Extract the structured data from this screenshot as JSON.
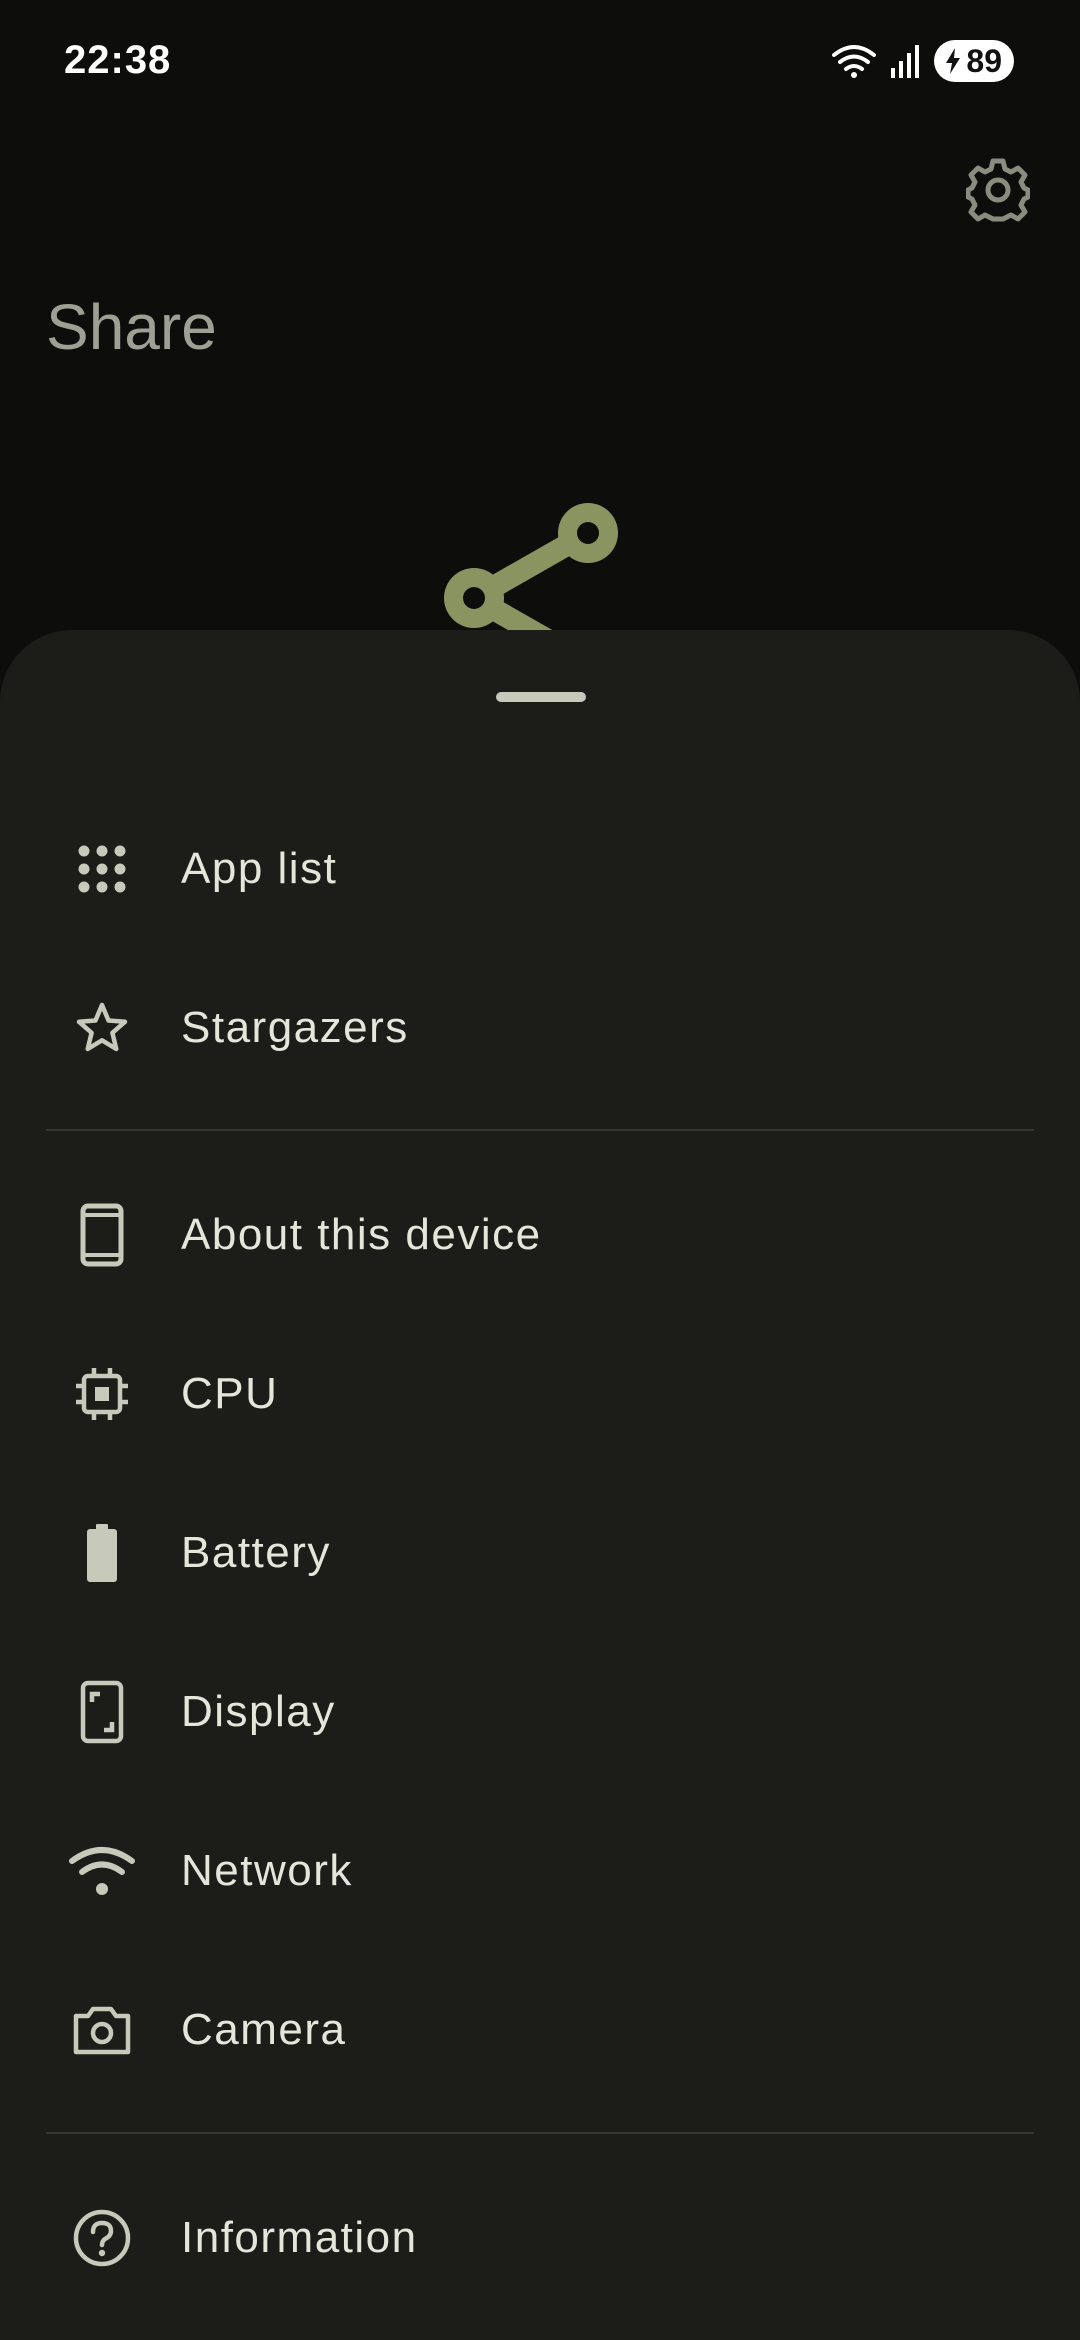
{
  "status_bar": {
    "time": "22:38",
    "battery_level": "89",
    "icons": [
      "wifi-icon",
      "cell-signal-icon",
      "battery-charging-icon"
    ]
  },
  "header": {
    "title": "Share",
    "settings_icon": "gear-icon"
  },
  "sheet": {
    "groups": [
      {
        "items": [
          {
            "label": "App list",
            "icon": "app-grid-icon"
          },
          {
            "label": "Stargazers",
            "icon": "star-icon"
          }
        ]
      },
      {
        "items": [
          {
            "label": "About this device",
            "icon": "phone-icon"
          },
          {
            "label": "CPU",
            "icon": "chip-icon"
          },
          {
            "label": "Battery",
            "icon": "battery-icon"
          },
          {
            "label": "Display",
            "icon": "display-icon"
          },
          {
            "label": "Network",
            "icon": "wifi-icon"
          },
          {
            "label": "Camera",
            "icon": "camera-icon"
          }
        ]
      },
      {
        "items": [
          {
            "label": "Information",
            "icon": "help-icon"
          }
        ]
      }
    ]
  },
  "colors": {
    "background": "#0d0e0b",
    "sheet": "#1c1d19",
    "accent": "#8a9460",
    "text": "#e5e6da",
    "icon": "#c7c9ba"
  }
}
